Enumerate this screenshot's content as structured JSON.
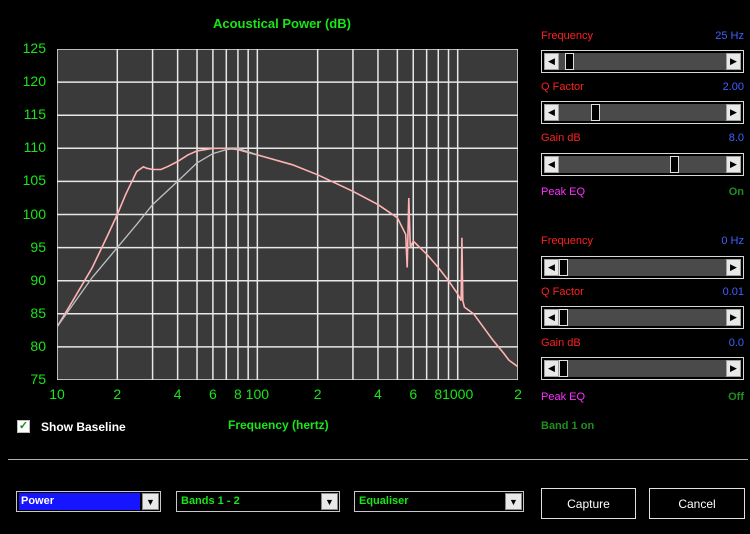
{
  "chart_data": {
    "type": "line",
    "title": "Acoustical Power (dB)",
    "xlabel": "Frequency (hertz)",
    "ylabel": "",
    "x_scale": "log",
    "xlim": [
      10,
      2000
    ],
    "ylim": [
      75,
      125
    ],
    "y_ticks": [
      "125",
      "120",
      "115",
      "110",
      "105",
      "100",
      "95",
      "90",
      "85",
      "80",
      "75"
    ],
    "x_ticks": [
      "10",
      "2",
      "4",
      "6",
      "8",
      "100",
      "2",
      "4",
      "6",
      "8",
      "1000",
      "2"
    ],
    "grid": true,
    "series": [
      {
        "name": "",
        "color": "#ffb3b3",
        "x": [
          10,
          12,
          15,
          18,
          20,
          22,
          25,
          27,
          28,
          30,
          33,
          36,
          40,
          45,
          50,
          60,
          70,
          80,
          100,
          150,
          200,
          300,
          400,
          500,
          550,
          560,
          570,
          580,
          600,
          700,
          800,
          900,
          1000,
          1040,
          1050,
          1060,
          1080,
          1200,
          1500,
          1700,
          1800,
          2000
        ],
        "y": [
          83,
          87,
          92,
          97,
          100,
          103,
          106.5,
          107.2,
          107,
          106.8,
          106.8,
          107.3,
          108,
          109,
          109.6,
          110,
          110,
          109.8,
          109,
          107.5,
          106,
          103.5,
          101.5,
          99.5,
          97,
          92,
          102.5,
          95,
          96,
          94,
          92,
          90,
          88,
          87,
          96.5,
          87,
          86,
          85,
          81,
          79,
          78,
          77
        ]
      },
      {
        "name": "",
        "color": "#c0c0c0",
        "x": [
          10,
          15,
          20,
          25,
          30,
          40,
          50,
          60,
          70,
          80,
          100
        ],
        "y": [
          83,
          90.5,
          95,
          98.5,
          101.5,
          105,
          107.8,
          109.2,
          109.8,
          110,
          109
        ]
      }
    ]
  },
  "band1": {
    "frequency_label": "Frequency",
    "frequency_value": "25 Hz",
    "frequency_pos": 0.04,
    "q_label": "Q Factor",
    "q_value": "2.00",
    "q_pos": 0.2,
    "gain_label": "Gain  dB",
    "gain_value": "8.0",
    "gain_pos": 0.7,
    "eq_label": "Peak EQ",
    "eq_value": "On"
  },
  "band2": {
    "frequency_label": "Frequency",
    "frequency_value": "0 Hz",
    "frequency_pos": 0.0,
    "q_label": "Q Factor",
    "q_value": "0.01",
    "q_pos": 0.0,
    "gain_label": "Gain  dB",
    "gain_value": "0.0",
    "gain_pos": 0.0,
    "eq_label": "Peak EQ",
    "eq_value": "Off"
  },
  "show_baseline": {
    "label": "Show Baseline",
    "checked": true,
    "check_glyph": "✓"
  },
  "band_status": "Band 1 on",
  "selects": {
    "mode": "Power",
    "bands": "Bands 1 - 2",
    "view": "Equaliser"
  },
  "buttons": {
    "capture": "Capture",
    "cancel": "Cancel"
  },
  "glyphs": {
    "left_arrow": "◀",
    "right_arrow": "▶",
    "down_arrow": "▼"
  }
}
